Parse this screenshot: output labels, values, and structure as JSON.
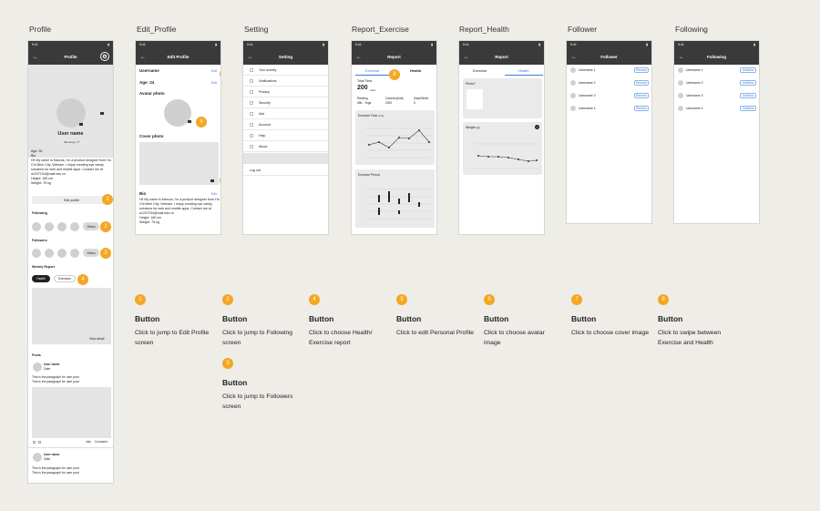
{
  "status_time": "9:41",
  "screens": {
    "profile": "Profile",
    "edit_profile": "Edit_Profile",
    "setting": "Setting",
    "report_exercise": "Report_Exercise",
    "report_health": "Report_Health",
    "follower": "Follower",
    "following": "Following"
  },
  "profile": {
    "nav_title": "Profile",
    "user_name": "User name",
    "running_tag": "Running • 1ˢᵗ",
    "age": "Age: 28",
    "bio_label": "Bio",
    "bio": "Hi! My name is Marcus, I'm a product designer from Ho Chi Minh City, Vietnam. I enjoy creating eye candy solutions for web and mobile apps. Contact me at a1237234@mail.edu.vn",
    "height": "Height: 180 cm",
    "weight": "Weight: 75 kg",
    "edit_button": "Edit profile",
    "following_label": "Following",
    "followers_label": "Followers",
    "others": "Others",
    "weekly_report": "Weekly Report",
    "health_tab": "Health",
    "exercise_tab": "Exercises",
    "view_detail": "View detail",
    "posts_label": "Posts",
    "post_user": "User name",
    "post_date": "Date",
    "post_text": "This is the paragraph for user post",
    "like": "Like",
    "comment": "Comment"
  },
  "edit_profile": {
    "nav_title": "Edit Profile",
    "username_label": "Username",
    "age": "Age: 24",
    "edit": "Edit",
    "avatar_label": "Avatar photo",
    "cover_label": "Cover photo",
    "bio_label": "Bio",
    "bio": "Hi! My name is Marcus, I'm a product designer from Ho Chi Minh City, Vietnam. I enjoy creating eye candy solutions for web and mobile apps. Contact me at a1237234@mail.edu.vn",
    "height": "Height: 180 cm",
    "weight": "Weight: 75 kg"
  },
  "setting": {
    "nav_title": "Setting",
    "items": [
      "Your activity",
      "Notifications",
      "Privacy",
      "Security",
      "Ads",
      "Account",
      "Help",
      "About"
    ],
    "logout": "Log out"
  },
  "report_exercise": {
    "nav_title": "Report",
    "tab_exercise": "Exercise",
    "tab_health": "Health",
    "total_time_label": "Total Time",
    "total_time_value": "200",
    "total_time_unit": "mins",
    "ranking_label": "Ranking",
    "ranking_value": "#56 - Yoga",
    "calories_label": "Calories(Kcal)",
    "calories_value": "2000",
    "days_label": "Days/Week",
    "days_value": "5",
    "exercise_time_label": "Exercise Time",
    "exercise_time_unit": "(min)",
    "exercise_period_label": "Exercise Period",
    "days": [
      "Mon",
      "Tue",
      "Wed",
      "Thu",
      "Fri",
      "Sat",
      "Sun"
    ]
  },
  "report_health": {
    "nav_title": "Report",
    "tab_exercise": "Exercise",
    "tab_health": "Health",
    "photo_label": "Photo?",
    "weight_label": "Weight",
    "weight_unit": "(kg)",
    "days": [
      "Mon",
      "Tue",
      "Wed",
      "Thu",
      "Fri",
      "Sat",
      "Sun"
    ]
  },
  "follower": {
    "nav_title": "Follower",
    "users": [
      "Username 1",
      "Username 2",
      "Username 3",
      "Username 4"
    ],
    "action": "Remove"
  },
  "following": {
    "nav_title": "Following",
    "users": [
      "Username 1",
      "Username 2",
      "Username 3",
      "Username 4"
    ],
    "action": "Unfollow"
  },
  "annotations": [
    {
      "num": "1",
      "title": "Button",
      "desc": "Click to jump to Edit Profile screen"
    },
    {
      "num": "2",
      "title": "Button",
      "desc": "Click to jump to Following screen"
    },
    {
      "num": "3",
      "title": "Button",
      "desc": "Click to jump to Followers screen"
    },
    {
      "num": "4",
      "title": "Button",
      "desc": "Click to choose Health/ Exercise report"
    },
    {
      "num": "5",
      "title": "Button",
      "desc": "Click to edit Personal Profile"
    },
    {
      "num": "6",
      "title": "Button",
      "desc": "Click to choose avatar image"
    },
    {
      "num": "7",
      "title": "Button",
      "desc": "Click to choose cover image"
    },
    {
      "num": "8",
      "title": "Button",
      "desc": "Click to swipe between Exercise and Health"
    }
  ],
  "colors": {
    "accent": "#f5a623",
    "navbar": "#3a3a3a",
    "link": "#3a7bd5",
    "background": "#efede8"
  }
}
